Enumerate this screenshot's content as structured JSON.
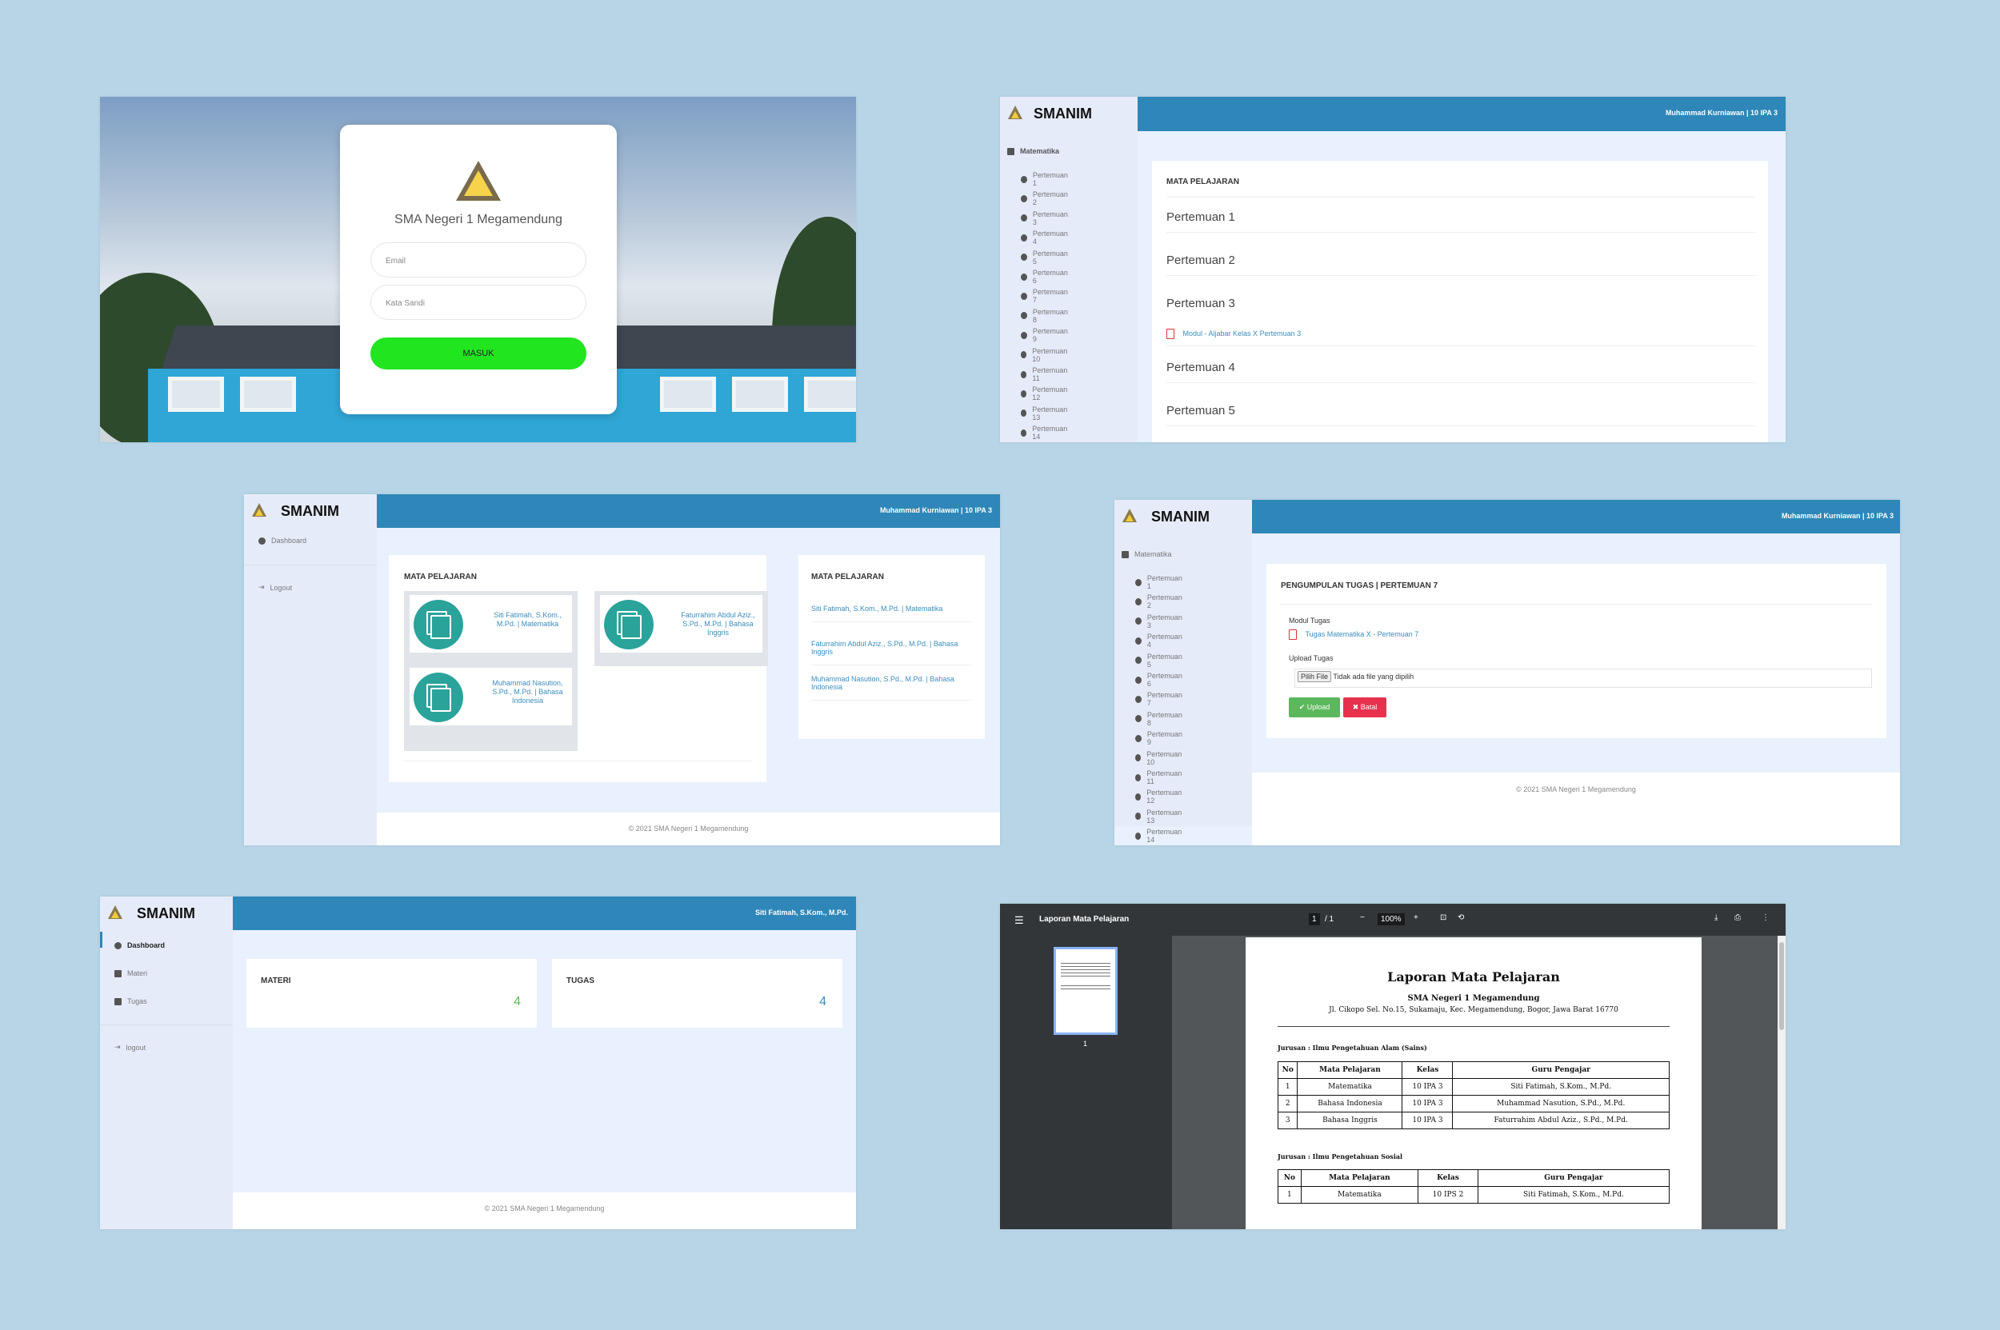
{
  "login": {
    "school_name": "SMA Negeri 1 Megamendung",
    "email_placeholder": "Email",
    "password_placeholder": "Kata Sandi",
    "submit_label": "MASUK"
  },
  "brand": "SMANIM",
  "student_user": "Muhammad Kurniawan | 10 IPA 3",
  "teacher_user": "Siti Fatimah, S.Kom., M.Pd.",
  "footer": "© 2021 SMA Negeri 1 Megamendung",
  "materi_page": {
    "subject": "Matematika",
    "meetings": [
      "Pertemuan 1",
      "Pertemuan 2",
      "Pertemuan 3",
      "Pertemuan 4",
      "Pertemuan 5",
      "Pertemuan 6",
      "Pertemuan 7",
      "Pertemuan 8",
      "Pertemuan 9",
      "Pertemuan 10",
      "Pertemuan 11",
      "Pertemuan 12",
      "Pertemuan 13",
      "Pertemuan 14"
    ],
    "card_title": "MATA PELAJARAN",
    "items": [
      "Pertemuan 1",
      "Pertemuan 2",
      "Pertemuan 3",
      "Pertemuan 4",
      "Pertemuan 5"
    ],
    "module_link": "Modul - Aljabar Kelas X Pertemuan 3"
  },
  "dashboard": {
    "nav": [
      "Dashboard",
      "Logout"
    ],
    "card_title": "MATA PELAJARAN",
    "subjects": [
      "Siti Fatimah, S.Kom., M.Pd. | Matematika",
      "Faturrahim Abdul Aziz., S.Pd., M.Pd. | Bahasa Inggris",
      "Muhammad Nasution, S.Pd., M.Pd. | Bahasa Indonesia"
    ]
  },
  "upload_page": {
    "subject": "Matematika",
    "title": "PENGUMPULAN TUGAS | PERTEMUAN 7",
    "module_label": "Modul Tugas",
    "module_link": "Tugas Matematika X - Pertemuan 7",
    "upload_label": "Upload Tugas",
    "file_button": "Pilih File",
    "file_status": "Tidak ada file yang dipilih",
    "upload_button": "✔ Upload",
    "cancel_button": "✖ Batal"
  },
  "teacher_dashboard": {
    "nav": [
      "Dashboard",
      "Materi",
      "Tugas",
      "logout"
    ],
    "materi_label": "MATERI",
    "materi_count": "4",
    "tugas_label": "TUGAS",
    "tugas_count": "4"
  },
  "pdf_viewer": {
    "doc_title": "Laporan Mata Pelajaran",
    "page_current": "1",
    "page_total": "/ 1",
    "zoom": "100%",
    "thumb_page": "1",
    "report": {
      "title": "Laporan Mata Pelajaran",
      "school": "SMA Negeri 1 Megamendung",
      "address": "Jl. Cikopo Sel. No.15, Sukamaju, Kec. Megamendung, Bogor, Jawa Barat 16770",
      "section1": "Jurusan : Ilmu Pengetahuan Alam (Sains)",
      "headers1": [
        "No",
        "Mata Pelajaran",
        "Kelas",
        "Guru Pengajar"
      ],
      "rows1": [
        [
          "1",
          "Matematika",
          "10 IPA 3",
          "Siti Fatimah, S.Kom., M.Pd."
        ],
        [
          "2",
          "Bahasa Indonesia",
          "10 IPA 3",
          "Muhammad Nasution, S.Pd., M.Pd."
        ],
        [
          "3",
          "Bahasa Inggris",
          "10 IPA 3",
          "Faturrahim Abdul Aziz., S.Pd., M.Pd."
        ]
      ],
      "section2": "Jurusan : Ilmu Pengetahuan Sosial",
      "headers2": [
        "No",
        "Mata Pelajaran",
        "Kelas",
        "Guru Pengajar"
      ],
      "rows2": [
        [
          "1",
          "Matematika",
          "10 IPS 2",
          "Siti Fatimah, S.Kom., M.Pd."
        ]
      ]
    }
  }
}
